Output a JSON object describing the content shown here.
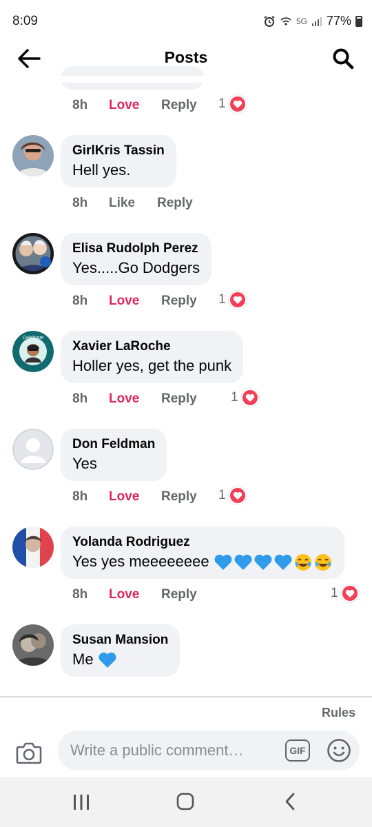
{
  "status_bar": {
    "time": "8:09",
    "network": "5G",
    "battery": "77%"
  },
  "header": {
    "title": "Posts",
    "back_icon": "arrow-left-icon",
    "search_icon": "search-icon"
  },
  "first_actions": {
    "time": "8h",
    "love": "Love",
    "reply": "Reply",
    "reaction_count": "1"
  },
  "comments": [
    {
      "author": "GirlKris Tassin",
      "text": "Hell yes.",
      "time": "8h",
      "reaction_label": "Like",
      "reply": "Reply",
      "reaction_count": ""
    },
    {
      "author": "Elisa Rudolph Perez",
      "text": "Yes.....Go Dodgers",
      "time": "8h",
      "reaction_label": "Love",
      "reply": "Reply",
      "reaction_count": "1"
    },
    {
      "author": "Xavier LaRoche",
      "text": "Holler yes, get the punk",
      "time": "8h",
      "reaction_label": "Love",
      "reply": "Reply",
      "reaction_count": "1"
    },
    {
      "author": "Don Feldman",
      "text": "Yes",
      "time": "8h",
      "reaction_label": "Love",
      "reply": "Reply",
      "reaction_count": "1"
    },
    {
      "author": "Yolanda Rodriguez",
      "text": "Yes yes meeeeeeee",
      "time": "8h",
      "reaction_label": "Love",
      "reply": "Reply",
      "reaction_count": "1"
    },
    {
      "author": "Susan Mansion",
      "text": "Me",
      "time": "",
      "reaction_label": "",
      "reply": "",
      "reaction_count": ""
    }
  ],
  "avatar_badge_text": "Celebrate",
  "composer": {
    "rules": "Rules",
    "placeholder": "Write a public comment…",
    "gif_label": "GIF"
  },
  "colors": {
    "love": "#e0245e",
    "bubble": "#f0f2f5",
    "secondary_text": "#65676b",
    "heart_badge": "#f33e58"
  }
}
